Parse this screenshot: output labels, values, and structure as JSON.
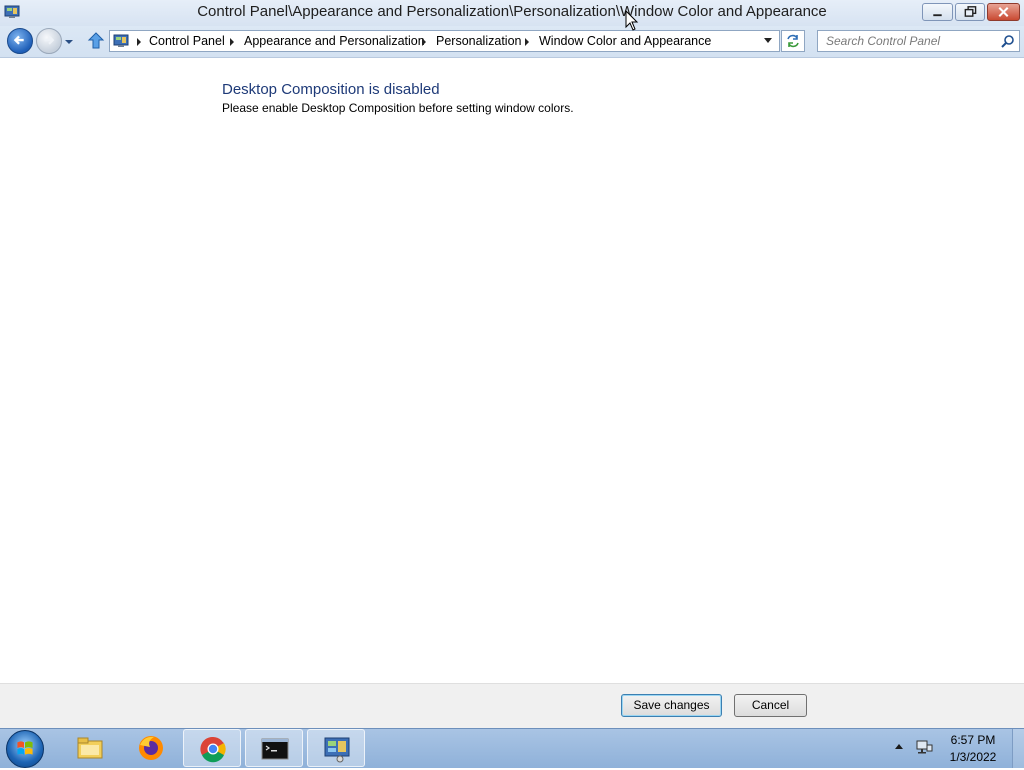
{
  "window": {
    "title": "Control Panel\\Appearance and Personalization\\Personalization\\Window Color and Appearance"
  },
  "address": {
    "crumbs": [
      "Control Panel",
      "Appearance and Personalization",
      "Personalization",
      "Window Color and Appearance"
    ]
  },
  "search": {
    "placeholder": "Search Control Panel"
  },
  "content": {
    "heading": "Desktop Composition is disabled",
    "message": "Please enable Desktop Composition before setting window colors."
  },
  "footer": {
    "save_label": "Save changes",
    "cancel_label": "Cancel"
  },
  "taskbar": {
    "items": [
      {
        "name": "file-explorer",
        "icon": "folder-icon"
      },
      {
        "name": "firefox",
        "icon": "firefox-icon"
      },
      {
        "name": "chrome",
        "icon": "chrome-icon"
      },
      {
        "name": "command-prompt",
        "icon": "cmd-icon"
      },
      {
        "name": "control-panel",
        "icon": "control-panel-icon"
      }
    ],
    "time": "6:57 PM",
    "date": "1/3/2022"
  },
  "colors": {
    "heading": "#1e3a78",
    "titlebar": "#dbe6f4",
    "taskbar": "#9bb9de"
  }
}
